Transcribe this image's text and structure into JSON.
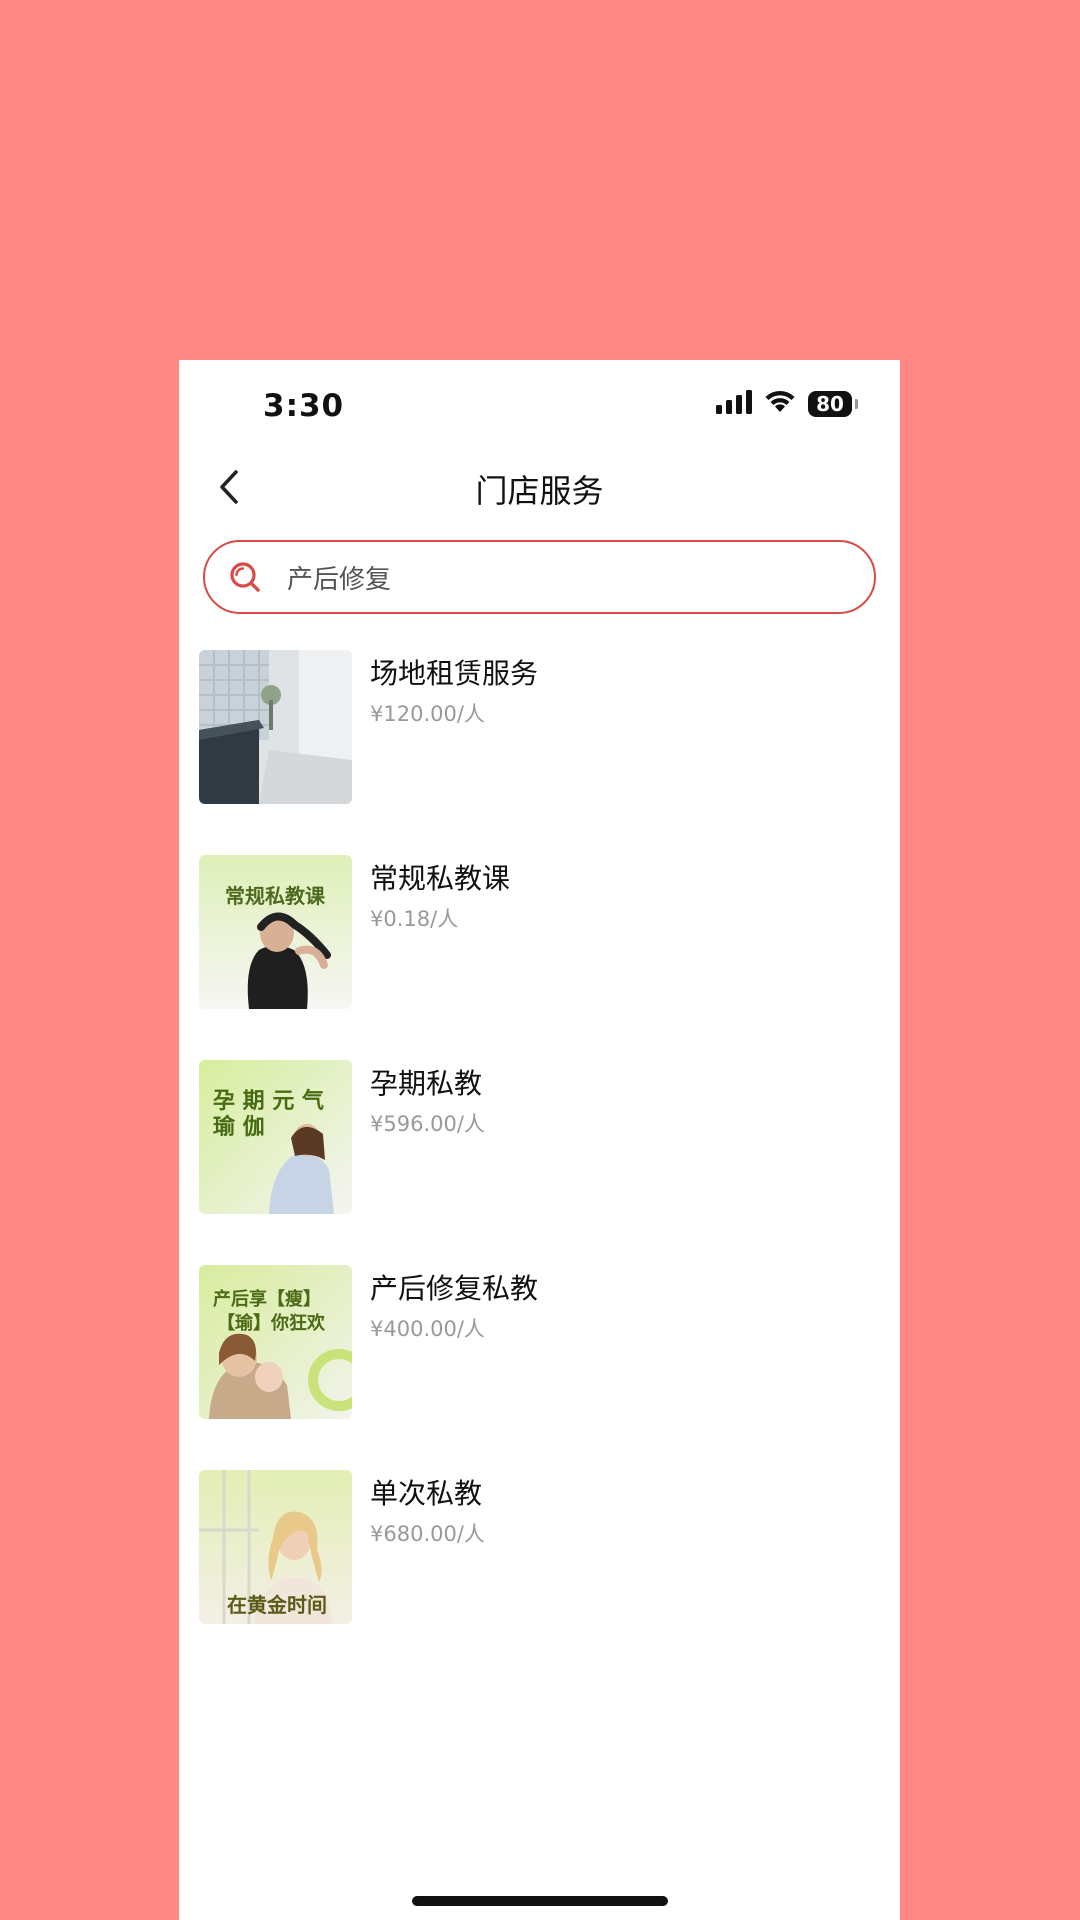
{
  "status_bar": {
    "time": "3:30",
    "battery": "80",
    "icons": [
      "signal-icon",
      "wifi-icon",
      "battery-icon"
    ]
  },
  "nav": {
    "title": "门店服务",
    "back_icon": "chevron-left-icon"
  },
  "search": {
    "value": "产后修复",
    "icon": "search-icon",
    "accent_color": "#D94A44"
  },
  "services": [
    {
      "name": "场地租赁服务",
      "price": "¥120.00/人"
    },
    {
      "name": "常规私教课",
      "price": "¥0.18/人",
      "thumb_text": "常规私教课"
    },
    {
      "name": "孕期私教",
      "price": "¥596.00/人",
      "thumb_text_1": "孕 期 元 气",
      "thumb_text_2": "瑜 伽"
    },
    {
      "name": "产后修复私教",
      "price": "¥400.00/人",
      "thumb_text_1": "产后享【瘦】",
      "thumb_text_2": "【瑜】你狂欢"
    },
    {
      "name": "单次私教",
      "price": "¥680.00/人",
      "thumb_text": "在黄金时间"
    }
  ],
  "colors": {
    "background": "#FF8885",
    "card": "#FFFFFF",
    "title_text": "#111111",
    "price_text": "#999999"
  }
}
